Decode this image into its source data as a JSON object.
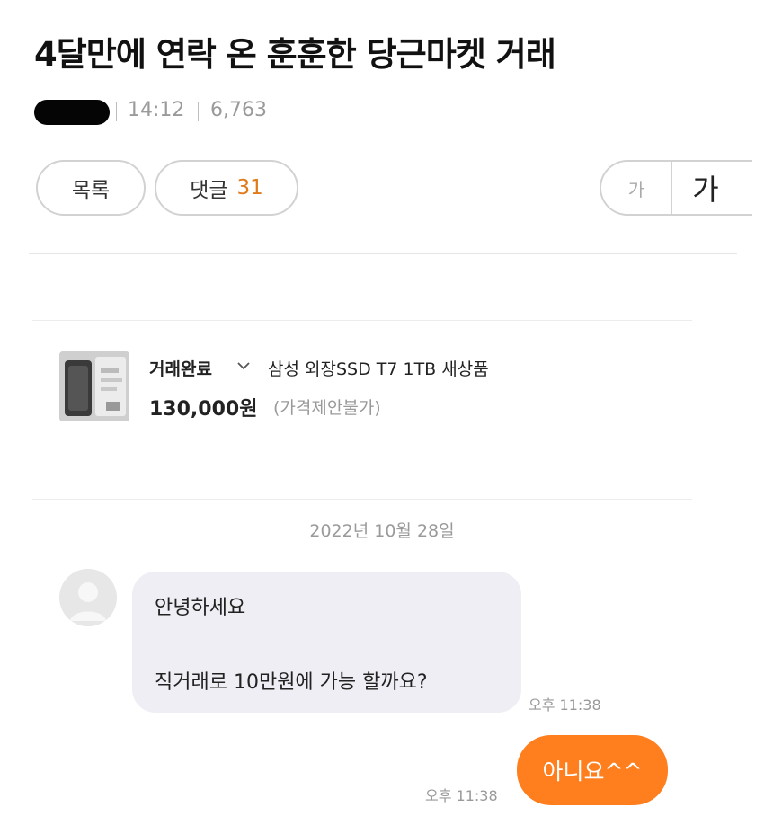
{
  "post": {
    "title": "4달만에 연락 온 훈훈한 당근마켓 거래",
    "time": "14:12",
    "views": "6,763"
  },
  "toolbar": {
    "list_label": "목록",
    "comments_label": "댓글",
    "comments_count": "31",
    "font_small": "가",
    "font_large": "가"
  },
  "product": {
    "status": "거래완료",
    "name": "삼성 외장SSD T7 1TB 새상품",
    "price": "130,000원",
    "price_note": "(가격제안불가)"
  },
  "chat": {
    "date": "2022년 10월 28일",
    "incoming": {
      "line1": "안녕하세요",
      "line2": "직거래로 10만원에 가능 할까요?",
      "time": "오후 11:38"
    },
    "outgoing": {
      "text": "아니요^^",
      "time": "오후 11:38"
    }
  },
  "icons": {
    "status_dropdown": "chevron-down-icon",
    "avatar": "user-silhouette-icon"
  },
  "colors": {
    "accent_orange": "#ff7e1d",
    "comment_count": "#e07a1a",
    "incoming_bubble": "#eeeef4"
  }
}
